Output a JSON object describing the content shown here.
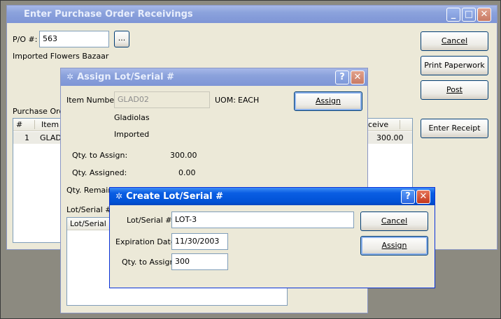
{
  "main": {
    "title": "Enter Purchase Order Receivings",
    "po_label": "P/O #:",
    "po_value": "563",
    "browse_label": "...",
    "vendor_name": "Imported Flowers Bazaar",
    "lines_caption": "Purchase Orde",
    "grid_headers": [
      "#",
      "Item N",
      "ceive"
    ],
    "grid_row": {
      "num": "1",
      "item": "GLAD",
      "receive": "300.00"
    },
    "buttons": {
      "cancel": "Cancel",
      "print": "Print Paperwork",
      "post": "Post",
      "enter_receipt": "Enter Receipt"
    }
  },
  "assign": {
    "title": "Assign Lot/Serial #",
    "item_number_label": "Item Number:",
    "item_number_value": "GLAD02",
    "uom_label": "UOM:",
    "uom_value": "EACH",
    "description": "Gladiolas",
    "category": "Imported",
    "qty_to_assign_label": "Qty. to Assign:",
    "qty_to_assign_value": "300.00",
    "qty_assigned_label": "Qty. Assigned:",
    "qty_assigned_value": "0.00",
    "qty_remaining_label": "Qty. Remaining",
    "lots_caption": "Lot/Serial # A",
    "lots_header": "Lot/Serial #",
    "assign_button": "Assign"
  },
  "create": {
    "title": "Create Lot/Serial #",
    "lot_label": "Lot/Serial #:",
    "lot_value": "LOT-3",
    "exp_label": "Expiration Date:",
    "exp_value": "11/30/2003",
    "qty_label": "Qty. to Assign:",
    "qty_value": "300",
    "cancel_button": "Cancel",
    "assign_button": "Assign"
  },
  "controls": {
    "help": "?",
    "close": "✕",
    "minimize": "_",
    "maximize": "□"
  }
}
